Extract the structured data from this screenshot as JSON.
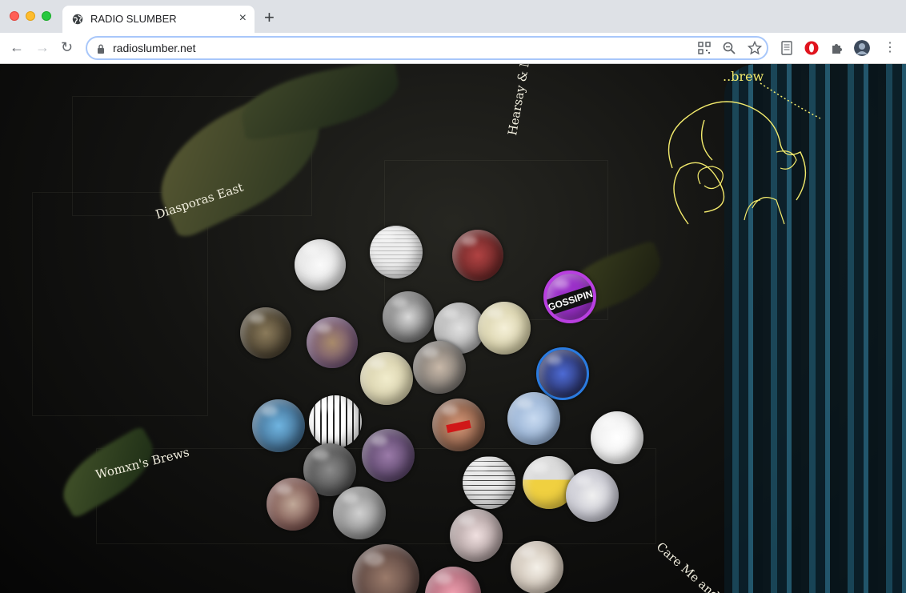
{
  "browser": {
    "tab_title": "RADIO SLUMBER",
    "tab_close": "×",
    "new_tab": "+",
    "url": "radioslumber.net",
    "nav_back": "←",
    "nav_forward": "→",
    "nav_reload": "↻",
    "menu": "⋮"
  },
  "page": {
    "labels": {
      "diasporas": "Diasporas East",
      "womxns": "Womxn's Brews",
      "hearsay": "Hearsay & M",
      "care": "Care Me and C",
      "brew": "..brew"
    },
    "bubble_text": {
      "gossiping": "GOSSIPING"
    }
  },
  "colors": {
    "accent_yellow": "#f2ea6c",
    "curtain_blue": "#2a6f8c",
    "gossip_purple": "#9b30c9"
  }
}
